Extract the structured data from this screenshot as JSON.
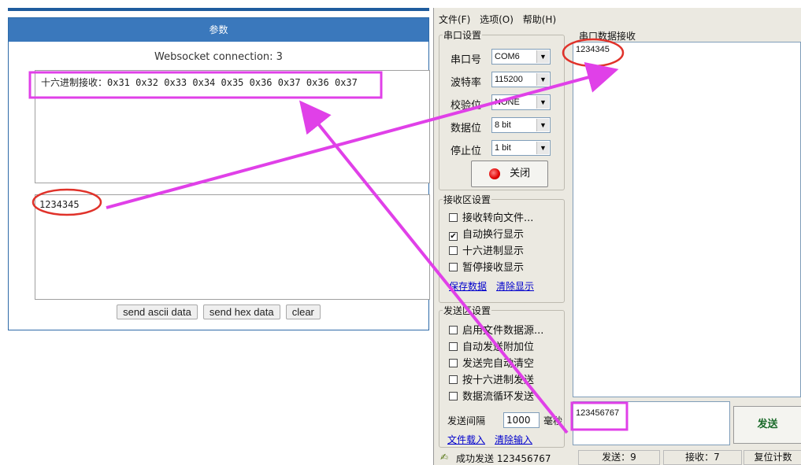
{
  "web": {
    "header": "参数",
    "connection": "Websocket connection: 3",
    "received_text": "十六进制接收：0x31 0x32 0x33 0x34 0x35 0x36 0x37 0x36 0x37",
    "input_text": "1234345",
    "buttons": [
      "send ascii data",
      "send hex data",
      "clear"
    ]
  },
  "serial": {
    "menu": [
      "文件(F)",
      "选项(O)",
      "帮助(H)"
    ],
    "port_group": {
      "title": "串口设置",
      "port_label": "串口号",
      "port_value": "COM6",
      "baud_label": "波特率",
      "baud_value": "115200",
      "parity_label": "校验位",
      "parity_value": "NONE",
      "databits_label": "数据位",
      "databits_value": "8 bit",
      "stopbits_label": "停止位",
      "stopbits_value": "1 bit",
      "close_button": "关闭"
    },
    "recv_group": {
      "title": "接收区设置",
      "options": [
        {
          "label": "接收转向文件...",
          "checked": false
        },
        {
          "label": "自动换行显示",
          "checked": true
        },
        {
          "label": "十六进制显示",
          "checked": false
        },
        {
          "label": "暂停接收显示",
          "checked": false
        }
      ],
      "save_link": "保存数据",
      "clear_link": "清除显示"
    },
    "send_group": {
      "title": "发送区设置",
      "options": [
        {
          "label": "启用文件数据源...",
          "checked": false
        },
        {
          "label": "自动发送附加位",
          "checked": false
        },
        {
          "label": "发送完自动清空",
          "checked": false
        },
        {
          "label": "按十六进制发送",
          "checked": false
        },
        {
          "label": "数据流循环发送",
          "checked": false
        }
      ],
      "interval_label": "发送间隔",
      "interval_value": "1000",
      "interval_unit": "毫秒",
      "load_link": "文件载入",
      "clear_input_link": "清除输入"
    },
    "recv_area_title": "串口数据接收",
    "recv_text": "1234345",
    "send_text": "123456767",
    "send_button": "发送",
    "status": {
      "message": "成功发送 123456767",
      "sent": "发送：9",
      "received": "接收：7",
      "reset": "复位计数"
    },
    "check_mark": "✔"
  },
  "colors": {
    "annotation_pink": "#e040e8",
    "annotation_red": "#e0322a",
    "header_blue": "#3a78bc"
  }
}
